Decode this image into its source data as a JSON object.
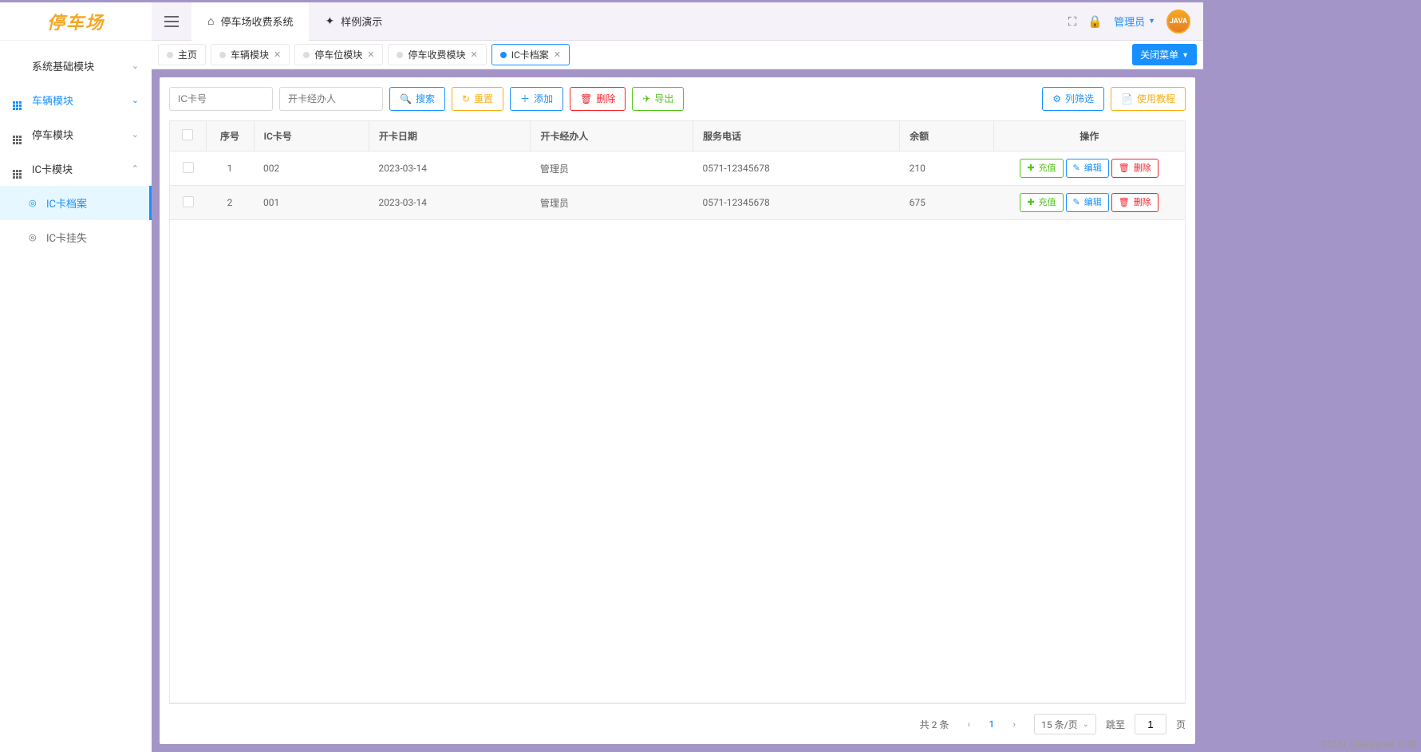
{
  "logo": "停车场",
  "header": {
    "tabs": [
      {
        "icon": "home",
        "label": "停车场收费系统",
        "active": true
      },
      {
        "icon": "sparkle",
        "label": "样例演示",
        "active": false
      }
    ],
    "user_label": "管理员",
    "avatar_text": "JAVA"
  },
  "sidebar": {
    "items": [
      {
        "label": "系统基础模块",
        "icon": "check",
        "expanded": false
      },
      {
        "label": "车辆模块",
        "icon": "grid",
        "expanded": true,
        "highlight": true
      },
      {
        "label": "停车模块",
        "icon": "grid",
        "expanded": false
      },
      {
        "label": "IC卡模块",
        "icon": "grid",
        "expanded": true,
        "children": [
          {
            "label": "IC卡档案",
            "icon": "target",
            "active": true
          },
          {
            "label": "IC卡挂失",
            "icon": "target",
            "active": false
          }
        ]
      }
    ]
  },
  "tabs_bar": {
    "tabs": [
      {
        "label": "主页",
        "closable": false,
        "active": false
      },
      {
        "label": "车辆模块",
        "closable": true,
        "active": false
      },
      {
        "label": "停车位模块",
        "closable": true,
        "active": false
      },
      {
        "label": "停车收费模块",
        "closable": true,
        "active": false
      },
      {
        "label": "IC卡档案",
        "closable": true,
        "active": true
      }
    ],
    "close_menu_label": "关闭菜单"
  },
  "toolbar": {
    "card_no_placeholder": "IC卡号",
    "operator_placeholder": "开卡经办人",
    "search_label": "搜索",
    "reset_label": "重置",
    "add_label": "添加",
    "delete_label": "删除",
    "export_label": "导出",
    "column_filter_label": "列筛选",
    "tutorial_label": "使用教程"
  },
  "table": {
    "columns": {
      "seq": "序号",
      "card_no": "IC卡号",
      "open_date": "开卡日期",
      "operator": "开卡经办人",
      "phone": "服务电话",
      "balance": "余额",
      "action": "操作"
    },
    "rows": [
      {
        "seq": "1",
        "card_no": "002",
        "open_date": "2023-03-14",
        "operator": "管理员",
        "phone": "0571-12345678",
        "balance": "210"
      },
      {
        "seq": "2",
        "card_no": "001",
        "open_date": "2023-03-14",
        "operator": "管理员",
        "phone": "0571-12345678",
        "balance": "675"
      }
    ],
    "row_actions": {
      "recharge": "充值",
      "edit": "编辑",
      "delete": "删除"
    }
  },
  "pagination": {
    "total_label": "共 2 条",
    "current": "1",
    "page_size_label": "15 条/页",
    "jump_label": "跳至",
    "goto_value": "1",
    "page_suffix": "页"
  },
  "watermark": "CSDN @Designer 小郑"
}
